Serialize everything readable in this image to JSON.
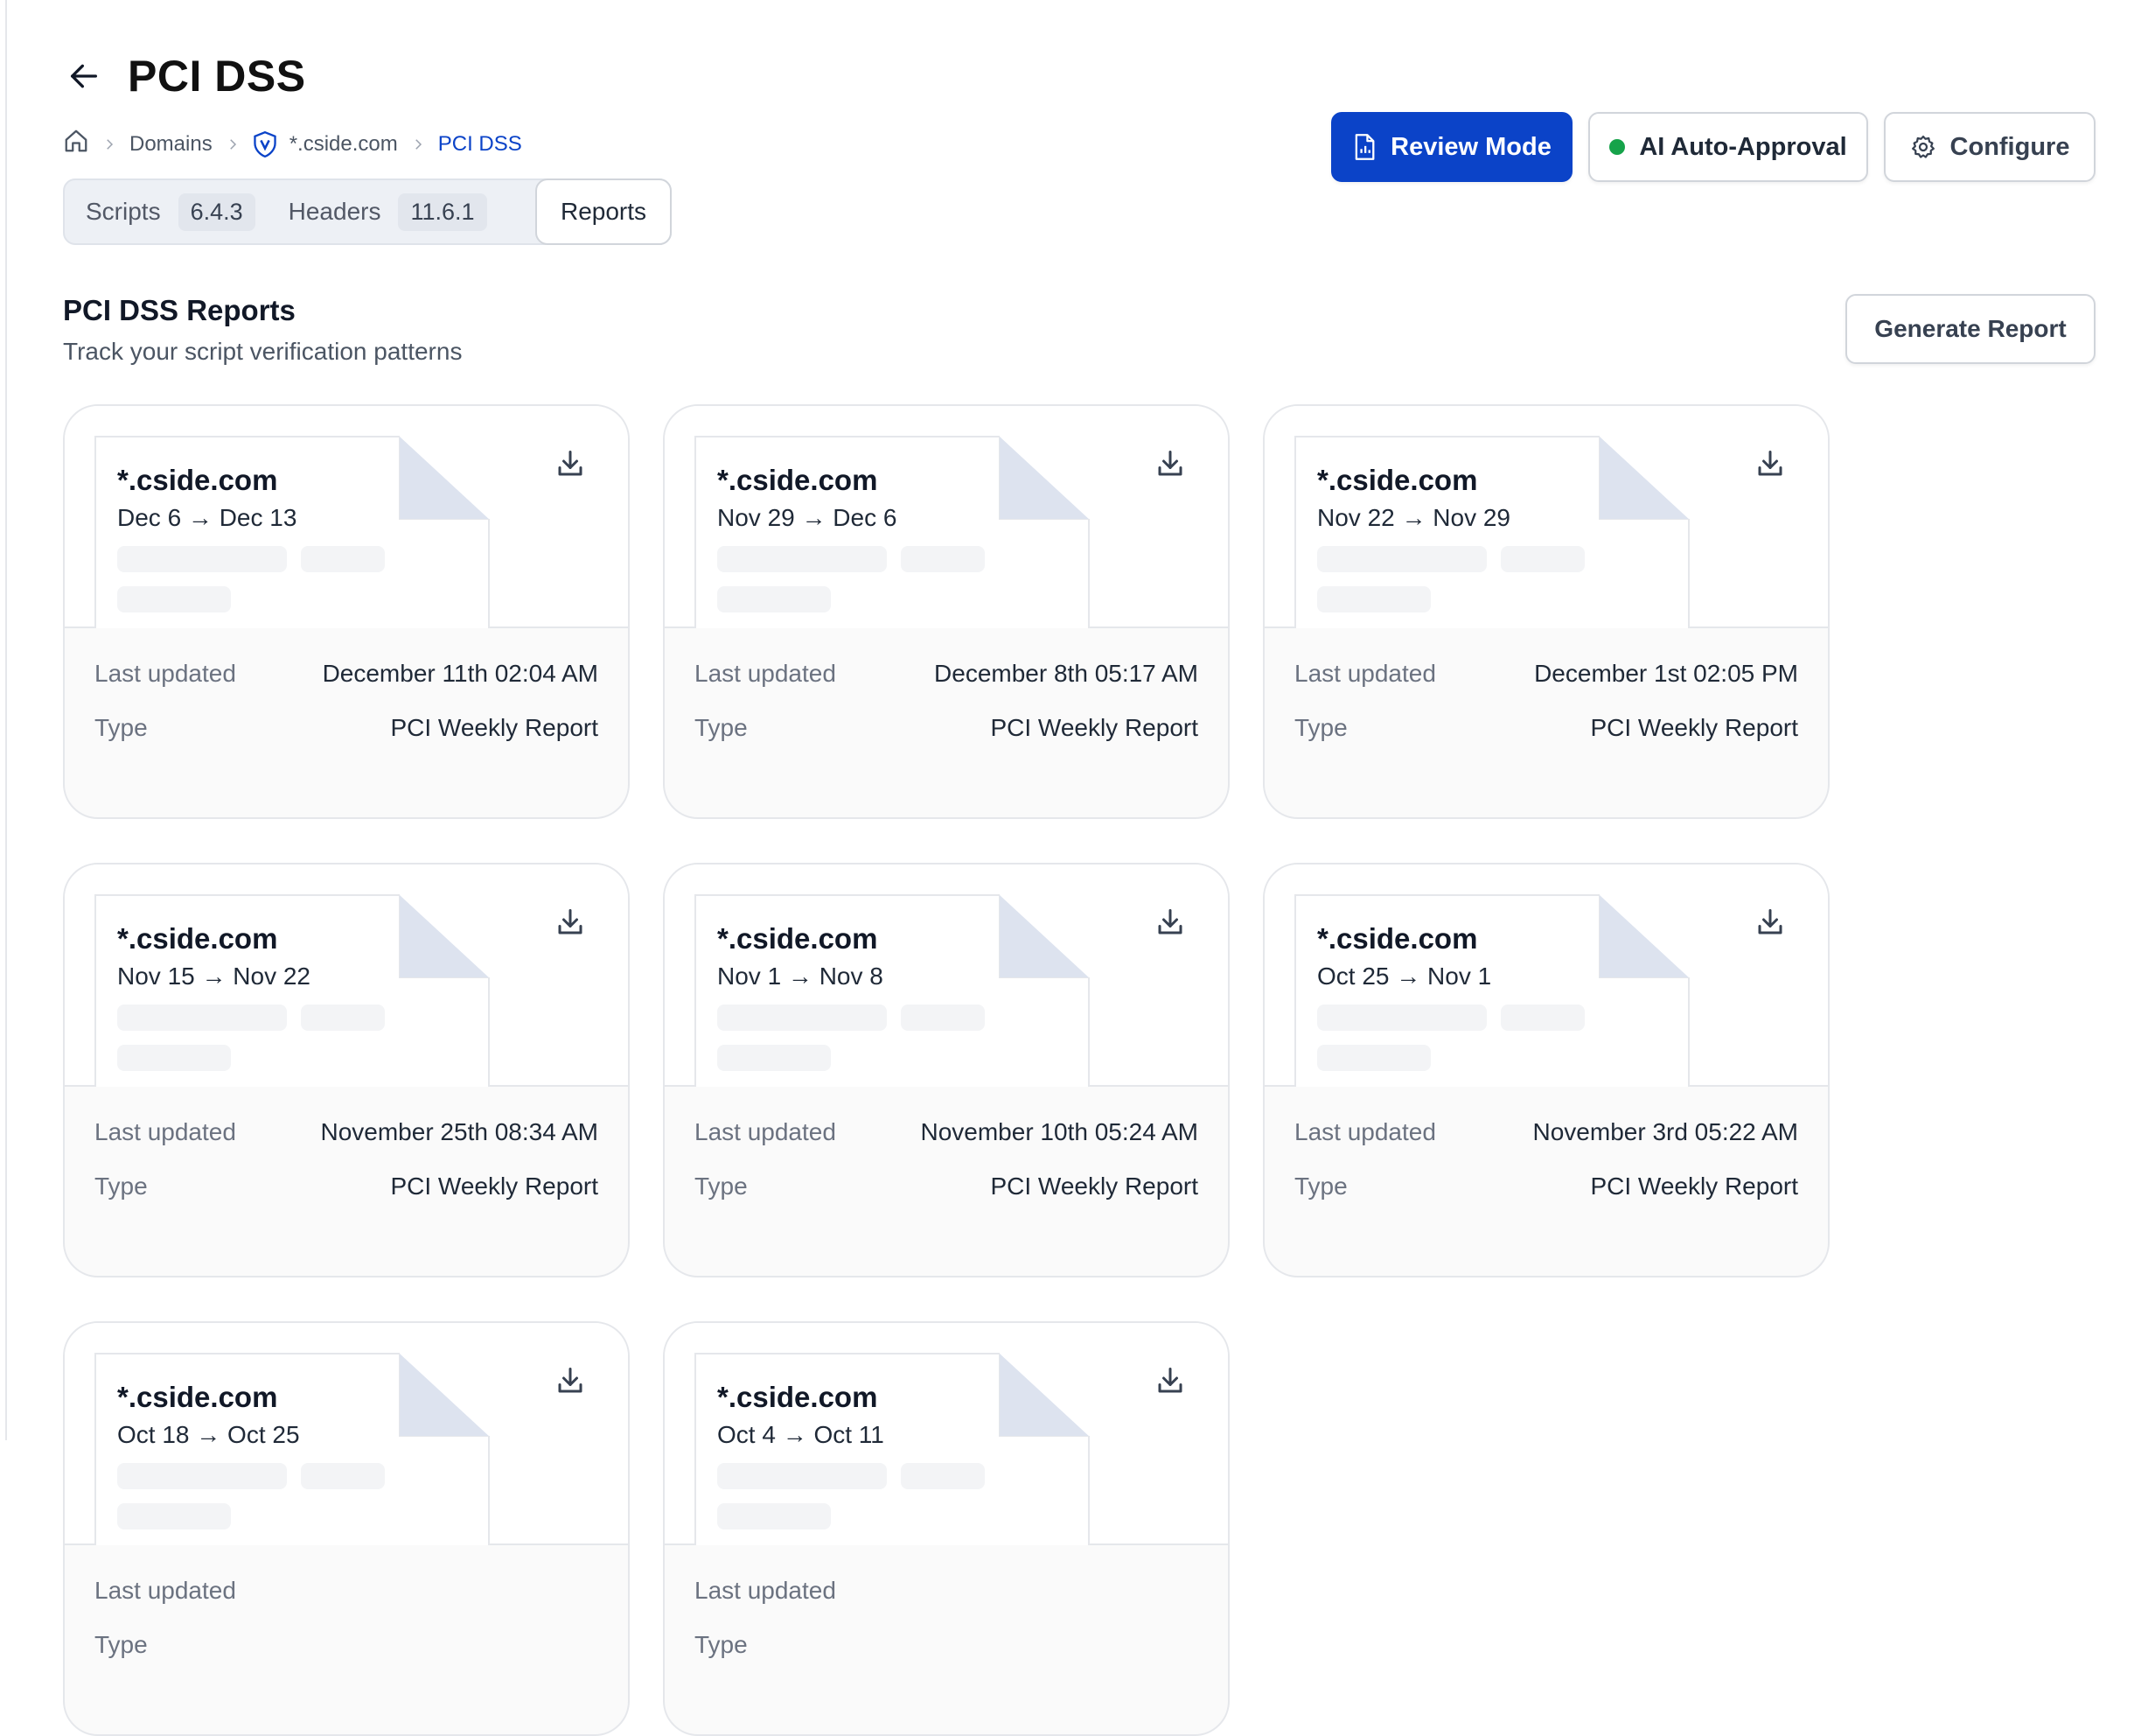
{
  "header": {
    "title": "PCI DSS",
    "back_icon": "arrow-left-icon"
  },
  "breadcrumb": {
    "home_icon": "home-icon",
    "items": [
      "Domains",
      "*.cside.com",
      "PCI DSS"
    ]
  },
  "tabs": [
    {
      "label": "Scripts",
      "count": "6.4.3"
    },
    {
      "label": "Headers",
      "count": "11.6.1"
    },
    {
      "label": "Reports",
      "active": true
    }
  ],
  "actions": {
    "review_mode": "Review Mode",
    "ai_auto_approval": "AI Auto-Approval",
    "configure": "Configure"
  },
  "section": {
    "title": "PCI DSS Reports",
    "subtitle": "Track your script verification patterns",
    "generate_button": "Generate Report"
  },
  "labels": {
    "last_updated": "Last updated",
    "type": "Type"
  },
  "reports": [
    {
      "domain": "*.cside.com",
      "range": "Dec 6 → Dec 13",
      "updated": "December 11th 02:04 AM",
      "type": "PCI Weekly Report"
    },
    {
      "domain": "*.cside.com",
      "range": "Nov 29 → Dec 6",
      "updated": "December 8th 05:17 AM",
      "type": "PCI Weekly Report"
    },
    {
      "domain": "*.cside.com",
      "range": "Nov 22 → Nov 29",
      "updated": "December 1st 02:05 PM",
      "type": "PCI Weekly Report"
    },
    {
      "domain": "*.cside.com",
      "range": "Nov 15 → Nov 22",
      "updated": "November 25th 08:34 AM",
      "type": "PCI Weekly Report"
    },
    {
      "domain": "*.cside.com",
      "range": "Nov 1 → Nov 8",
      "updated": "November 10th 05:24 AM",
      "type": "PCI Weekly Report"
    },
    {
      "domain": "*.cside.com",
      "range": "Oct 25 → Nov 1",
      "updated": "November 3rd 05:22 AM",
      "type": "PCI Weekly Report"
    },
    {
      "domain": "*.cside.com",
      "range": "Oct 18 → Oct 25",
      "updated": "",
      "type": ""
    },
    {
      "domain": "*.cside.com",
      "range": "Oct 4 → Oct 11",
      "updated": "",
      "type": ""
    }
  ],
  "colors": {
    "primary": "#0b43c8",
    "status_green": "#16a34a",
    "fold": "#dde3ef"
  }
}
